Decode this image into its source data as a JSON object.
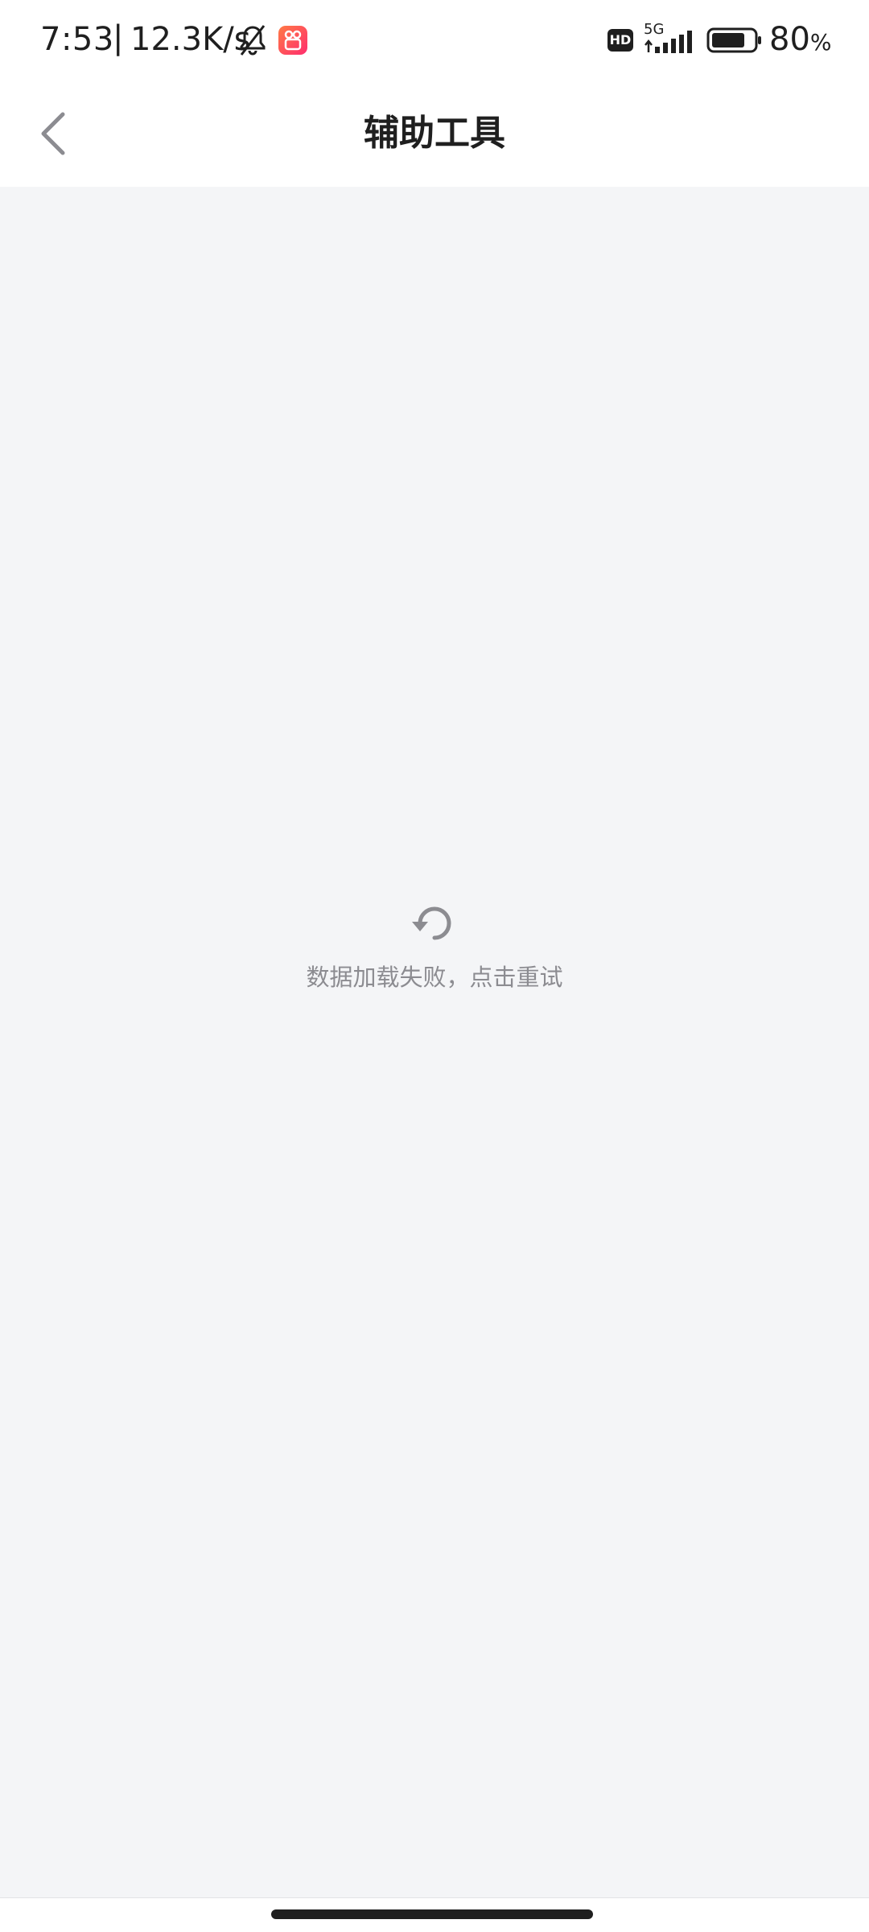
{
  "status_bar": {
    "time": "7:53",
    "separator": "|",
    "net_speed": "12.3K/s",
    "network_type": "5G",
    "hd_label": "HD",
    "battery_value": "80",
    "battery_unit": "%",
    "battery_level": 0.8
  },
  "header": {
    "title": "辅助工具"
  },
  "error_state": {
    "message": "数据加载失败，点击重试"
  },
  "colors": {
    "page_background": "#f4f5f7",
    "header_background": "#ffffff",
    "title_text": "#1f1f1f",
    "secondary_text": "#8c8c91",
    "icon_gray": "#8c8c91"
  },
  "icons": {
    "back": "back-chevron-icon",
    "refresh": "refresh-icon",
    "notifications_muted": "bell-muted-icon",
    "app_badge": "app-badge-icon",
    "signal": "signal-icon",
    "battery": "battery-icon"
  }
}
